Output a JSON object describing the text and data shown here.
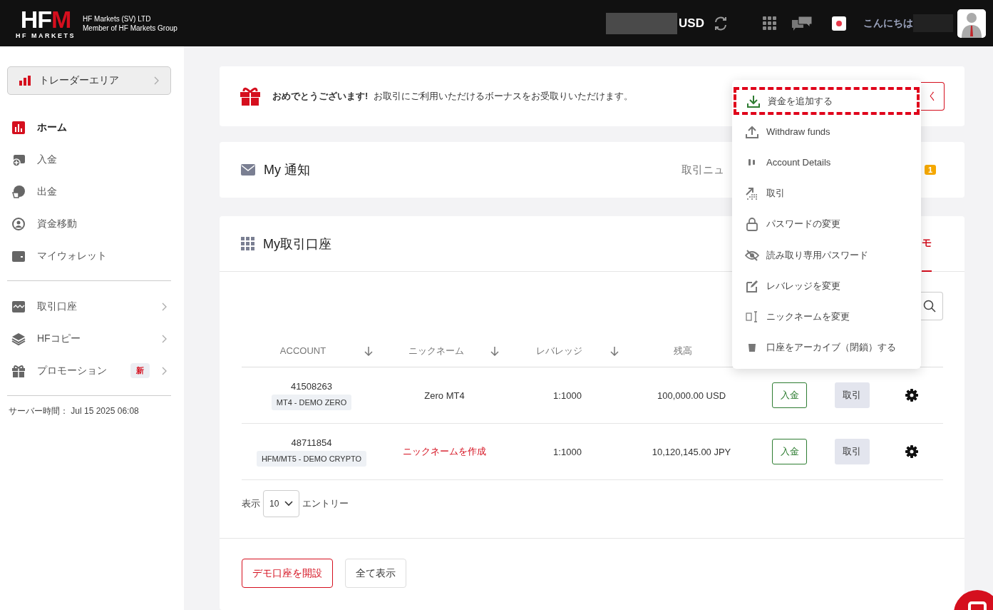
{
  "header": {
    "logo": "HFM",
    "logo_subtext": "HF MARKETS",
    "company_lines": [
      "HF Markets (SV) LTD",
      "Member of HF Markets Group"
    ],
    "currency": "USD",
    "greeting": "こんにちは"
  },
  "sidebar": {
    "trader_area": "トレーダーエリア",
    "items": [
      {
        "label": "ホーム",
        "selected": true,
        "chevron": false
      },
      {
        "label": "入金",
        "selected": false,
        "chevron": false
      },
      {
        "label": "出金",
        "selected": false,
        "chevron": false
      },
      {
        "label": "資金移動",
        "selected": false,
        "chevron": false
      },
      {
        "label": "マイウォレット",
        "selected": false,
        "chevron": false
      }
    ],
    "items_2": [
      {
        "label": "取引口座",
        "selected": false,
        "chevron": true
      },
      {
        "label": "HFコピー",
        "selected": false,
        "chevron": true
      },
      {
        "label": "プロモーション",
        "selected": false,
        "chevron": true,
        "badge": "新"
      }
    ],
    "server_time": "サーバー時間： Jul 15 2025 06:08"
  },
  "bonus_banner": {
    "title": "おめでとうございます!",
    "text": "お取引にご利用いただけるボーナスをお受取りいただけます。",
    "button": "く"
  },
  "notifications": {
    "title": "My 通知",
    "link": "取引ニュ",
    "badge": "1"
  },
  "accounts": {
    "title": "My取引口座",
    "tab": {
      "label": "モ",
      "selected": true
    },
    "columns": [
      "ACCOUNT",
      "ニックネーム",
      "レバレッジ",
      "残高"
    ],
    "rows": [
      {
        "number": "41508263",
        "type": "MT4 - DEMO ZERO",
        "nickname": "Zero MT4",
        "nickname_is_link": false,
        "leverage": "1:1000",
        "balance": "100,000.00 USD",
        "deposit": "入金",
        "trade": "取引"
      },
      {
        "number": "48711854",
        "type": "HFM/MT5 - DEMO CRYPTO",
        "nickname": "ニックネームを作成",
        "nickname_is_link": true,
        "leverage": "1:1000",
        "balance": "10,120,145.00 JPY",
        "deposit": "入金",
        "trade": "取引"
      }
    ],
    "show_label": "表示",
    "page_size": "10",
    "entries_label": "エントリー",
    "buttons": [
      {
        "label": "デモ口座を開設",
        "kind": "primary"
      },
      {
        "label": "全て表示",
        "kind": "secondary"
      }
    ]
  },
  "account_menu": {
    "items": [
      {
        "label": "資金を追加する",
        "highlighted": true
      },
      {
        "label": "Withdraw funds",
        "highlighted": false
      },
      {
        "label": "Account Details",
        "highlighted": false
      },
      {
        "label": "取引",
        "highlighted": false
      },
      {
        "label": "パスワードの変更",
        "highlighted": false
      },
      {
        "label": "読み取り専用パスワード",
        "highlighted": false
      },
      {
        "label": "レバレッジを変更",
        "highlighted": false
      },
      {
        "label": "ニックネームを変更",
        "highlighted": false
      },
      {
        "label": "口座をアーカイブ（閉鎖）する",
        "highlighted": false
      }
    ]
  }
}
